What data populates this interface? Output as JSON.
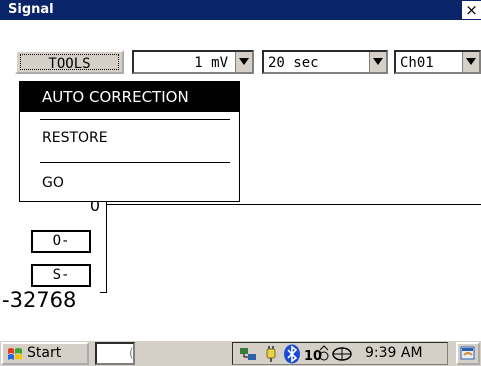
{
  "window": {
    "title": "Signal",
    "close_glyph": "×"
  },
  "toolbar": {
    "tools_label": "TOOLS",
    "scale_value": "1 mV",
    "time_value": "20 sec",
    "channel_value": "Ch01"
  },
  "menu": {
    "items": [
      {
        "label": "AUTO CORRECTION",
        "selected": true
      },
      {
        "label": "RESTORE"
      },
      {
        "label": "GO"
      }
    ]
  },
  "plot": {
    "y_zero_label": "0",
    "y_min_label": "-32768",
    "offset_button": "O-",
    "scale_button": "S-"
  },
  "taskbar": {
    "start_label": "Start",
    "task_item_label": "(",
    "clock": "9:39 AM"
  },
  "icons": {
    "start": "windows-flag-icon",
    "tray": [
      "network-icon",
      "power-plug-icon",
      "bluetooth-icon",
      "input-method-icon",
      "connection-icon"
    ],
    "desktop": "desktop-icon"
  },
  "colors": {
    "titlebar": "#0a246a",
    "menu_highlight": "#000000",
    "chrome": "#d4d0c8",
    "bluetooth": "#1a4bd6"
  }
}
